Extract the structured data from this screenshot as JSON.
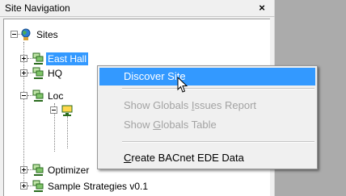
{
  "panel": {
    "title": "Site Navigation",
    "close_glyph": "×"
  },
  "tree": {
    "nodes": [
      {
        "label": "Sites",
        "icon": "globe-person-icon"
      },
      {
        "label": "East Hall",
        "icon": "computer-network-icon",
        "selected": true
      },
      {
        "label": "HQ",
        "icon": "computer-network-icon"
      },
      {
        "label": "Loc",
        "icon": "computer-network-icon"
      },
      {
        "label": "Optimizer",
        "icon": "computer-network-icon"
      },
      {
        "label": "Sample Strategies v0.1",
        "icon": "computer-network-icon"
      }
    ]
  },
  "context_menu": {
    "items": [
      {
        "label": "Discover Site",
        "mnemonic": "",
        "state": "highlighted"
      },
      {
        "label_pre": "Show Globals ",
        "label_mn": "I",
        "label_post": "ssues Report",
        "state": "disabled"
      },
      {
        "label_pre": "Show ",
        "label_mn": "G",
        "label_post": "lobals Table",
        "state": "disabled"
      },
      {
        "label_pre": "",
        "label_mn": "C",
        "label_post": "reate BACnet EDE Data",
        "state": "enabled"
      }
    ]
  },
  "colors": {
    "selection": "#3399ff",
    "panel_bg": "#f0f0f0",
    "workspace_bg": "#ababab",
    "disabled_text": "#a3a3a3"
  }
}
